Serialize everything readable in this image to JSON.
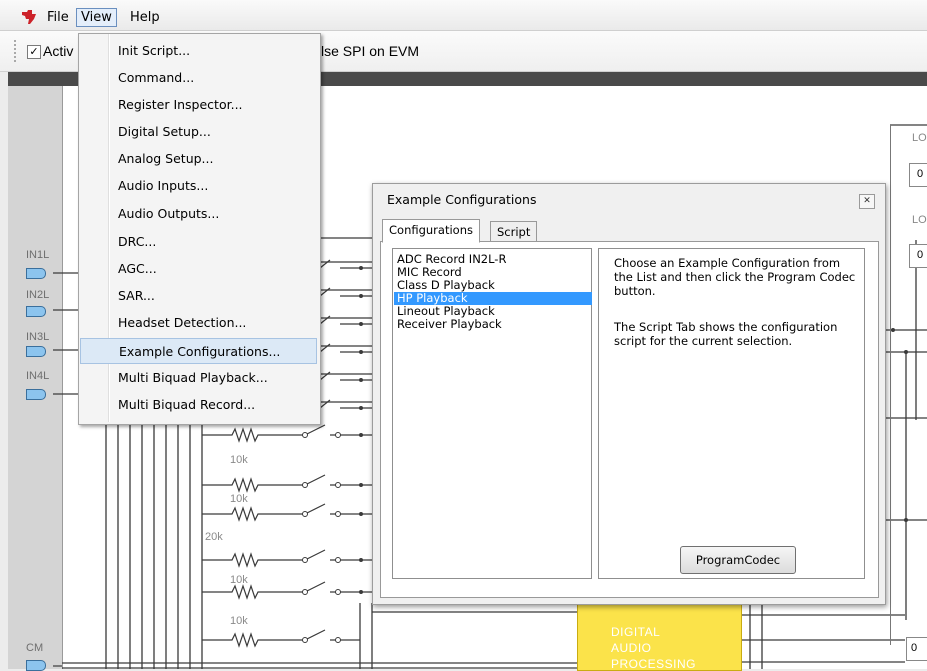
{
  "menubar": {
    "items": [
      "File",
      "View",
      "Help"
    ]
  },
  "toolbar": {
    "active_label": "Activ",
    "spi_label": "lse SPI on EVM"
  },
  "view_menu": {
    "items": [
      "Init Script...",
      "Command...",
      "Register Inspector...",
      "Digital Setup...",
      "Analog Setup...",
      "Audio Inputs...",
      "Audio Outputs...",
      "DRC...",
      "AGC...",
      "SAR...",
      "Headset Detection...",
      "Example Configurations...",
      "Multi Biquad Playback...",
      "Multi Biquad Record..."
    ],
    "highlighted": "Example Configurations..."
  },
  "schematic": {
    "pins": [
      "IN1L",
      "IN2L",
      "IN3L",
      "IN4L",
      "CM"
    ],
    "resistors": [
      "10k",
      "10k",
      "20k",
      "10k",
      "10k"
    ],
    "block_lines": [
      "DIGITAL",
      "AUDIO",
      "PROCESSING"
    ],
    "right_labels": [
      "LO",
      "0",
      "LO",
      "0",
      "0"
    ]
  },
  "dialog": {
    "title": "Example Configurations",
    "close_glyph": "x",
    "tabs": [
      "Configurations",
      "Script"
    ],
    "configurations": [
      "ADC Record IN2L-R",
      "MIC Record",
      "Class D Playback",
      "HP Playback",
      "Lineout Playback",
      "Receiver Playback"
    ],
    "selected": "HP Playback",
    "description_1": "Choose an Example Configuration from the List and then click the Program Codec button.",
    "description_2": "The Script Tab shows the configuration script for the current selection.",
    "program_button": "ProgramCodec"
  },
  "colors": {
    "selection": "#3399ff",
    "menu_highlight": "#dce9f6",
    "dsp_block": "#fbe34a",
    "pin": "#8cc4ee",
    "logo": "#cc2229"
  }
}
